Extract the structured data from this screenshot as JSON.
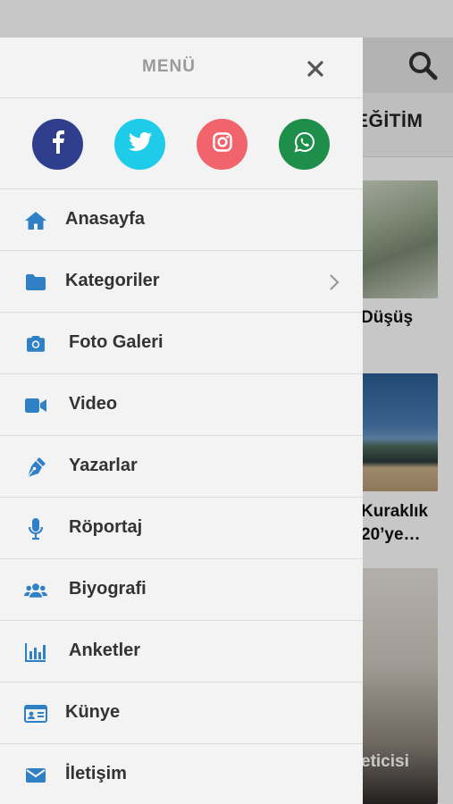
{
  "background": {
    "category_label": "EĞİTİM",
    "captions": [
      "Düşüş",
      "Kuraklık",
      "20’ye…",
      "eticisi"
    ]
  },
  "drawer": {
    "title": "MENÜ",
    "close_icon": "close-icon",
    "social": [
      {
        "name": "facebook",
        "icon": "facebook-icon",
        "color": "#2f3f8e"
      },
      {
        "name": "twitter",
        "icon": "twitter-icon",
        "color": "#1ecbe9"
      },
      {
        "name": "instagram",
        "icon": "instagram-icon",
        "color": "#f2646b"
      },
      {
        "name": "whatsapp",
        "icon": "whatsapp-icon",
        "color": "#1e8e4b"
      }
    ],
    "items": [
      {
        "label": "Anasayfa",
        "icon": "home-icon"
      },
      {
        "label": "Kategoriler",
        "icon": "folder-icon",
        "has_submenu": true
      },
      {
        "label": "Foto Galeri",
        "icon": "camera-icon"
      },
      {
        "label": "Video",
        "icon": "video-camera-icon"
      },
      {
        "label": "Yazarlar",
        "icon": "pen-icon"
      },
      {
        "label": "Röportaj",
        "icon": "microphone-icon"
      },
      {
        "label": "Biyografi",
        "icon": "users-icon"
      },
      {
        "label": "Anketler",
        "icon": "poll-chart-icon"
      },
      {
        "label": "Künye",
        "icon": "id-card-icon"
      },
      {
        "label": "İletişim",
        "icon": "envelope-icon"
      }
    ]
  },
  "colors": {
    "icon_blue": "#2f80c4",
    "label": "#333333",
    "drawer_bg": "#f3f3f3"
  }
}
